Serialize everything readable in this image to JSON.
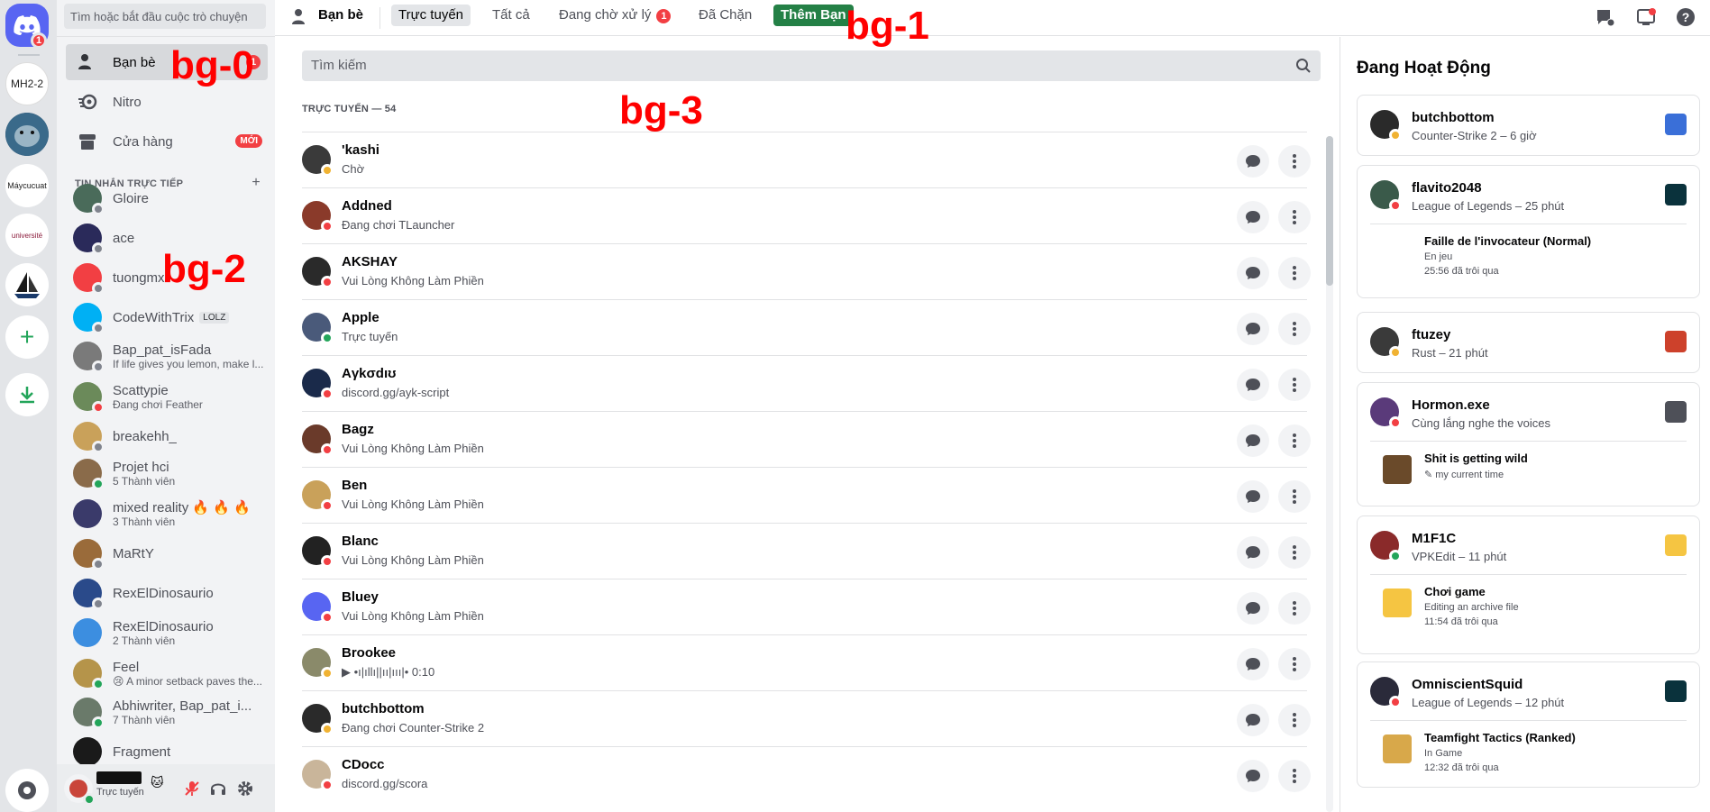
{
  "servers": [
    {
      "label": "",
      "kind": "home",
      "badge": "1",
      "color": "#5865f2"
    },
    {
      "label": "MH2-2",
      "color": "#ffffff"
    },
    {
      "label": "",
      "color": "#2f4f6b"
    },
    {
      "label": "Máycucuat",
      "color": "#ffffff"
    },
    {
      "label": "université",
      "color": "#ffffff"
    },
    {
      "label": "",
      "color": "#ffffff"
    }
  ],
  "sidebar": {
    "search_placeholder": "Tìm hoặc bắt đầu cuộc trò chuyện",
    "nav": [
      {
        "label": "Bạn bè",
        "badge": "1"
      },
      {
        "label": "Nitro"
      },
      {
        "label": "Cửa hàng",
        "pill": "MỚI"
      }
    ],
    "dm_header": "TIN NHẮN TRỰC TIẾP",
    "dm_add": "+",
    "dms": [
      {
        "name": "Gloire",
        "sub": "",
        "status": "off",
        "color": "#4a6b5a"
      },
      {
        "name": "ace",
        "sub": "",
        "status": "off",
        "color": "#2a2a5a"
      },
      {
        "name": "tuongmx",
        "sub": "",
        "status": "off",
        "color": "#f23f43"
      },
      {
        "name": "CodeWithTrix",
        "sub": "",
        "tag": "LOLZ",
        "status": "off",
        "color": "#00b0f4"
      },
      {
        "name": "Bap_pat_isFada",
        "sub": "If life gives you lemon, make l...",
        "status": "off",
        "color": "#7a7a7a"
      },
      {
        "name": "Scattypie",
        "sub": "Đang chơi Feather",
        "status": "dnd",
        "color": "#6b8a5a"
      },
      {
        "name": "breakehh_",
        "sub": "",
        "status": "off",
        "color": "#c9a15a"
      },
      {
        "name": "Projet hci",
        "sub": "5 Thành viên",
        "status": "on",
        "color": "#8a6b4a"
      },
      {
        "name": "mixed reality 🔥 🔥 🔥",
        "sub": "3 Thành viên",
        "status": "",
        "color": "#3a3a6a"
      },
      {
        "name": "MaRtY",
        "sub": "",
        "status": "off",
        "color": "#9a6b3a"
      },
      {
        "name": "RexElDinosaurio",
        "sub": "",
        "status": "off",
        "color": "#2a4a8a"
      },
      {
        "name": "RexElDinosaurio",
        "sub": "2 Thành viên",
        "status": "",
        "color": "#3c8ee0"
      },
      {
        "name": "Feel",
        "sub": "😢 A minor setback paves the...",
        "status": "on",
        "color": "#b5944a"
      },
      {
        "name": "Abhiwriter, Bap_pat_i...",
        "sub": "7 Thành viên",
        "status": "on",
        "color": "#6a7a6a"
      },
      {
        "name": "Fragment",
        "sub": "",
        "status": "",
        "color": "#1a1a1a"
      }
    ],
    "user": {
      "status_text": "Trực tuyến"
    }
  },
  "topbar": {
    "title": "Bạn bè",
    "tabs": [
      "Trực tuyến",
      "Tất cả",
      "Đang chờ xử lý",
      "Đã Chặn"
    ],
    "pending_badge": "1",
    "add_friend": "Thêm Bạn"
  },
  "friends": {
    "search_placeholder": "Tìm kiếm",
    "header": "TRỰC TUYẾN — 54",
    "rows": [
      {
        "name": "'kashi",
        "sub": "Chờ",
        "status": "idle",
        "color": "#3a3a3a"
      },
      {
        "name": "Addned",
        "sub": "Đang chơi TLauncher",
        "status": "dnd",
        "color": "#8a3a2a"
      },
      {
        "name": "AKSHAY",
        "sub": "Vui Lòng Không Làm Phiền",
        "status": "dnd",
        "color": "#2a2a2a"
      },
      {
        "name": "Apple",
        "sub": "Trực tuyến",
        "status": "on",
        "color": "#4a5a7a"
      },
      {
        "name": "Aγkσdıʊ",
        "sub": "discord.gg/ayk-script",
        "status": "dnd",
        "color": "#1a2a4a"
      },
      {
        "name": "Bagz",
        "sub": "Vui Lòng Không Làm Phiền",
        "status": "dnd",
        "color": "#6a3a2a"
      },
      {
        "name": "Ben",
        "sub": "Vui Lòng Không Làm Phiền",
        "status": "dnd",
        "color": "#c9a15a"
      },
      {
        "name": "Blanc",
        "sub": "Vui Lòng Không Làm Phiền",
        "status": "dnd",
        "color": "#222222"
      },
      {
        "name": "Bluey",
        "sub": "Vui Lòng Không Làm Phiền",
        "status": "dnd",
        "color": "#5865f2"
      },
      {
        "name": "Brookee",
        "sub": "▶ •ı|ıllı||ıı|ııı|• 0:10",
        "status": "idle",
        "color": "#8a8a6a"
      },
      {
        "name": "butchbottom",
        "sub": "Đang chơi Counter-Strike 2",
        "status": "idle",
        "color": "#2a2a2a"
      },
      {
        "name": "CDocc",
        "sub": "discord.gg/scora",
        "status": "dnd",
        "color": "#c9b59a"
      }
    ]
  },
  "active": {
    "title": "Đang Hoạt Động",
    "cards": [
      {
        "name": "butchbottom",
        "sub": "Counter-Strike 2 – 6 giờ",
        "status": "idle",
        "color": "#2a2a2a",
        "game_color": "#3a6fd8"
      },
      {
        "name": "flavito2048",
        "sub": "League of Legends – 25 phút",
        "status": "dnd",
        "color": "#3a5a4a",
        "game_color": "#0a323c",
        "detail": {
          "l1": "Faille de l'invocateur (Normal)",
          "l2": "En jeu",
          "l3": "25:56 đã trôi qua",
          "art": "#ffffff"
        }
      },
      {
        "name": "ftuzey",
        "sub": "Rust – 21 phút",
        "status": "idle",
        "color": "#3a3a3a",
        "game_color": "#cd412b"
      },
      {
        "name": "Hormon.exe",
        "sub": "Cùng lắng nghe the voices",
        "status": "dnd",
        "color": "#5a3a7a",
        "game_color": "#4e5058",
        "detail": {
          "l1": "Shit is getting wild",
          "l2": "✎ my current time",
          "l3": "",
          "art": "#6a4a2a"
        }
      },
      {
        "name": "M1F1C",
        "sub": "VPKEdit – 11 phút",
        "status": "on",
        "color": "#8a2a2a",
        "game_color": "#f5c542",
        "detail": {
          "l1": "Chơi game",
          "l2": "Editing an archive file",
          "l3": "11:54 đã trôi qua",
          "art": "#f5c542"
        }
      },
      {
        "name": "OmniscientSquid",
        "sub": "League of Legends – 12 phút",
        "status": "dnd",
        "color": "#2a2a3a",
        "game_color": "#0a323c",
        "detail": {
          "l1": "Teamfight Tactics (Ranked)",
          "l2": "In Game",
          "l3": "12:32 đã trôi qua",
          "art": "#d8a84a"
        }
      }
    ]
  },
  "overlay_labels": [
    "bg-0",
    "bg-1",
    "bg-2",
    "bg-3"
  ],
  "colors": {
    "blurple": "#5865f2",
    "green": "#248046",
    "red": "#f23f43"
  }
}
